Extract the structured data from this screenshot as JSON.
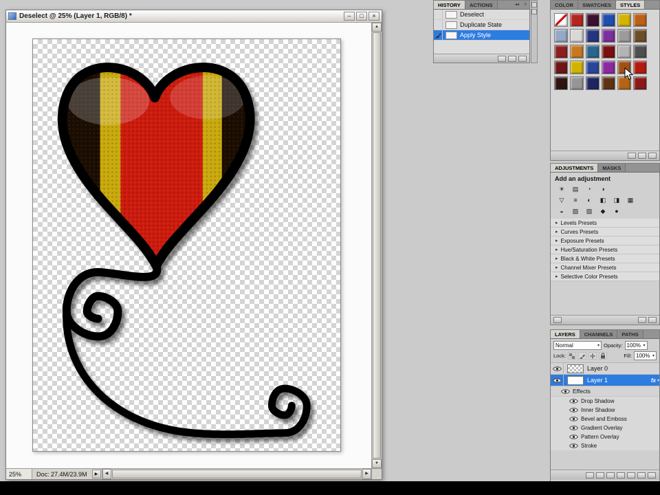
{
  "icons": {
    "menu": "≡",
    "collapse": "◂◂",
    "up": "▲",
    "down": "▼",
    "left": "◀",
    "right": "▶",
    "dropdown": "▾",
    "expand": "▸",
    "popup": "▶",
    "minimize": "–",
    "maximize": "□",
    "close": "×"
  },
  "doc_window": {
    "title": "Deselect @ 25% (Layer 1, RGB/8) *",
    "status_zoom": "25%",
    "status_doc": "Doc: 27.4M/23.9M"
  },
  "history": {
    "tabs": [
      {
        "label": "HISTORY",
        "active": true
      },
      {
        "label": "ACTIONS",
        "active": false
      }
    ],
    "items": [
      {
        "label": "Deselect",
        "selected": false
      },
      {
        "label": "Duplicate State",
        "selected": false
      },
      {
        "label": "Apply Style",
        "selected": true
      }
    ]
  },
  "styles_panel": {
    "tabs": [
      {
        "label": "COLOR",
        "active": false
      },
      {
        "label": "SWATCHES",
        "active": false
      },
      {
        "label": "STYLES",
        "active": true
      }
    ],
    "swatches": [
      "none",
      "#b3261c",
      "#3c1230",
      "#1f4fae",
      "#d3b400",
      "#bd5f16",
      "#93a9c6",
      "#d8d8d8",
      "#25357e",
      "#7c2f9e",
      "#9b9b9b",
      "#6b4f28",
      "#8c2020",
      "#c87820",
      "#2b648c",
      "#7a0f0f",
      "#b4b4b4",
      "#4f4f4f",
      "#6e1414",
      "#d2b400",
      "#28459b",
      "#8c28a0",
      "#a05014",
      "#b41a10",
      "#2f1410",
      "#969696",
      "#1f2560",
      "#5f3214",
      "#b46414",
      "#8a1a1a"
    ]
  },
  "adjustments": {
    "tabs": [
      {
        "label": "ADJUSTMENTS",
        "active": true
      },
      {
        "label": "MASKS",
        "active": false
      }
    ],
    "heading": "Add an adjustment",
    "icon_rows": [
      [
        {
          "name": "brightness-contrast",
          "glyph": "☀"
        },
        {
          "name": "levels",
          "glyph": "▤"
        },
        {
          "name": "curves",
          "glyph": "◔"
        },
        {
          "name": "exposure",
          "glyph": "◑"
        }
      ],
      [
        {
          "name": "vibrance",
          "glyph": "▽"
        },
        {
          "name": "hue-saturation",
          "glyph": "≡"
        },
        {
          "name": "color-balance",
          "glyph": "◐"
        },
        {
          "name": "black-white",
          "glyph": "◧"
        },
        {
          "name": "photo-filter",
          "glyph": "◨"
        },
        {
          "name": "channel-mixer",
          "glyph": "▦"
        }
      ],
      [
        {
          "name": "invert",
          "glyph": "◒"
        },
        {
          "name": "posterize",
          "glyph": "▧"
        },
        {
          "name": "threshold",
          "glyph": "▨"
        },
        {
          "name": "gradient-map",
          "glyph": "◆"
        },
        {
          "name": "selective-color",
          "glyph": "●"
        }
      ]
    ],
    "presets": [
      "Levels Presets",
      "Curves Presets",
      "Exposure Presets",
      "Hue/Saturation Presets",
      "Black & White Presets",
      "Channel Mixer Presets",
      "Selective Color Presets"
    ]
  },
  "layers": {
    "tabs": [
      {
        "label": "LAYERS",
        "active": true
      },
      {
        "label": "CHANNELS",
        "active": false
      },
      {
        "label": "PATHS",
        "active": false
      }
    ],
    "blend_mode": "Normal",
    "opacity_label": "Opacity:",
    "opacity_value": "100%",
    "lock_label": "Lock:",
    "fill_label": "Fill:",
    "fill_value": "100%",
    "layer0": "Layer 0",
    "layer1": "Layer 1",
    "fx_badge": "fx",
    "effects_header": "Effects",
    "effects": [
      "Drop Shadow",
      "Inner Shadow",
      "Bevel and Emboss",
      "Gradient Overlay",
      "Pattern Overlay",
      "Stroke"
    ]
  }
}
